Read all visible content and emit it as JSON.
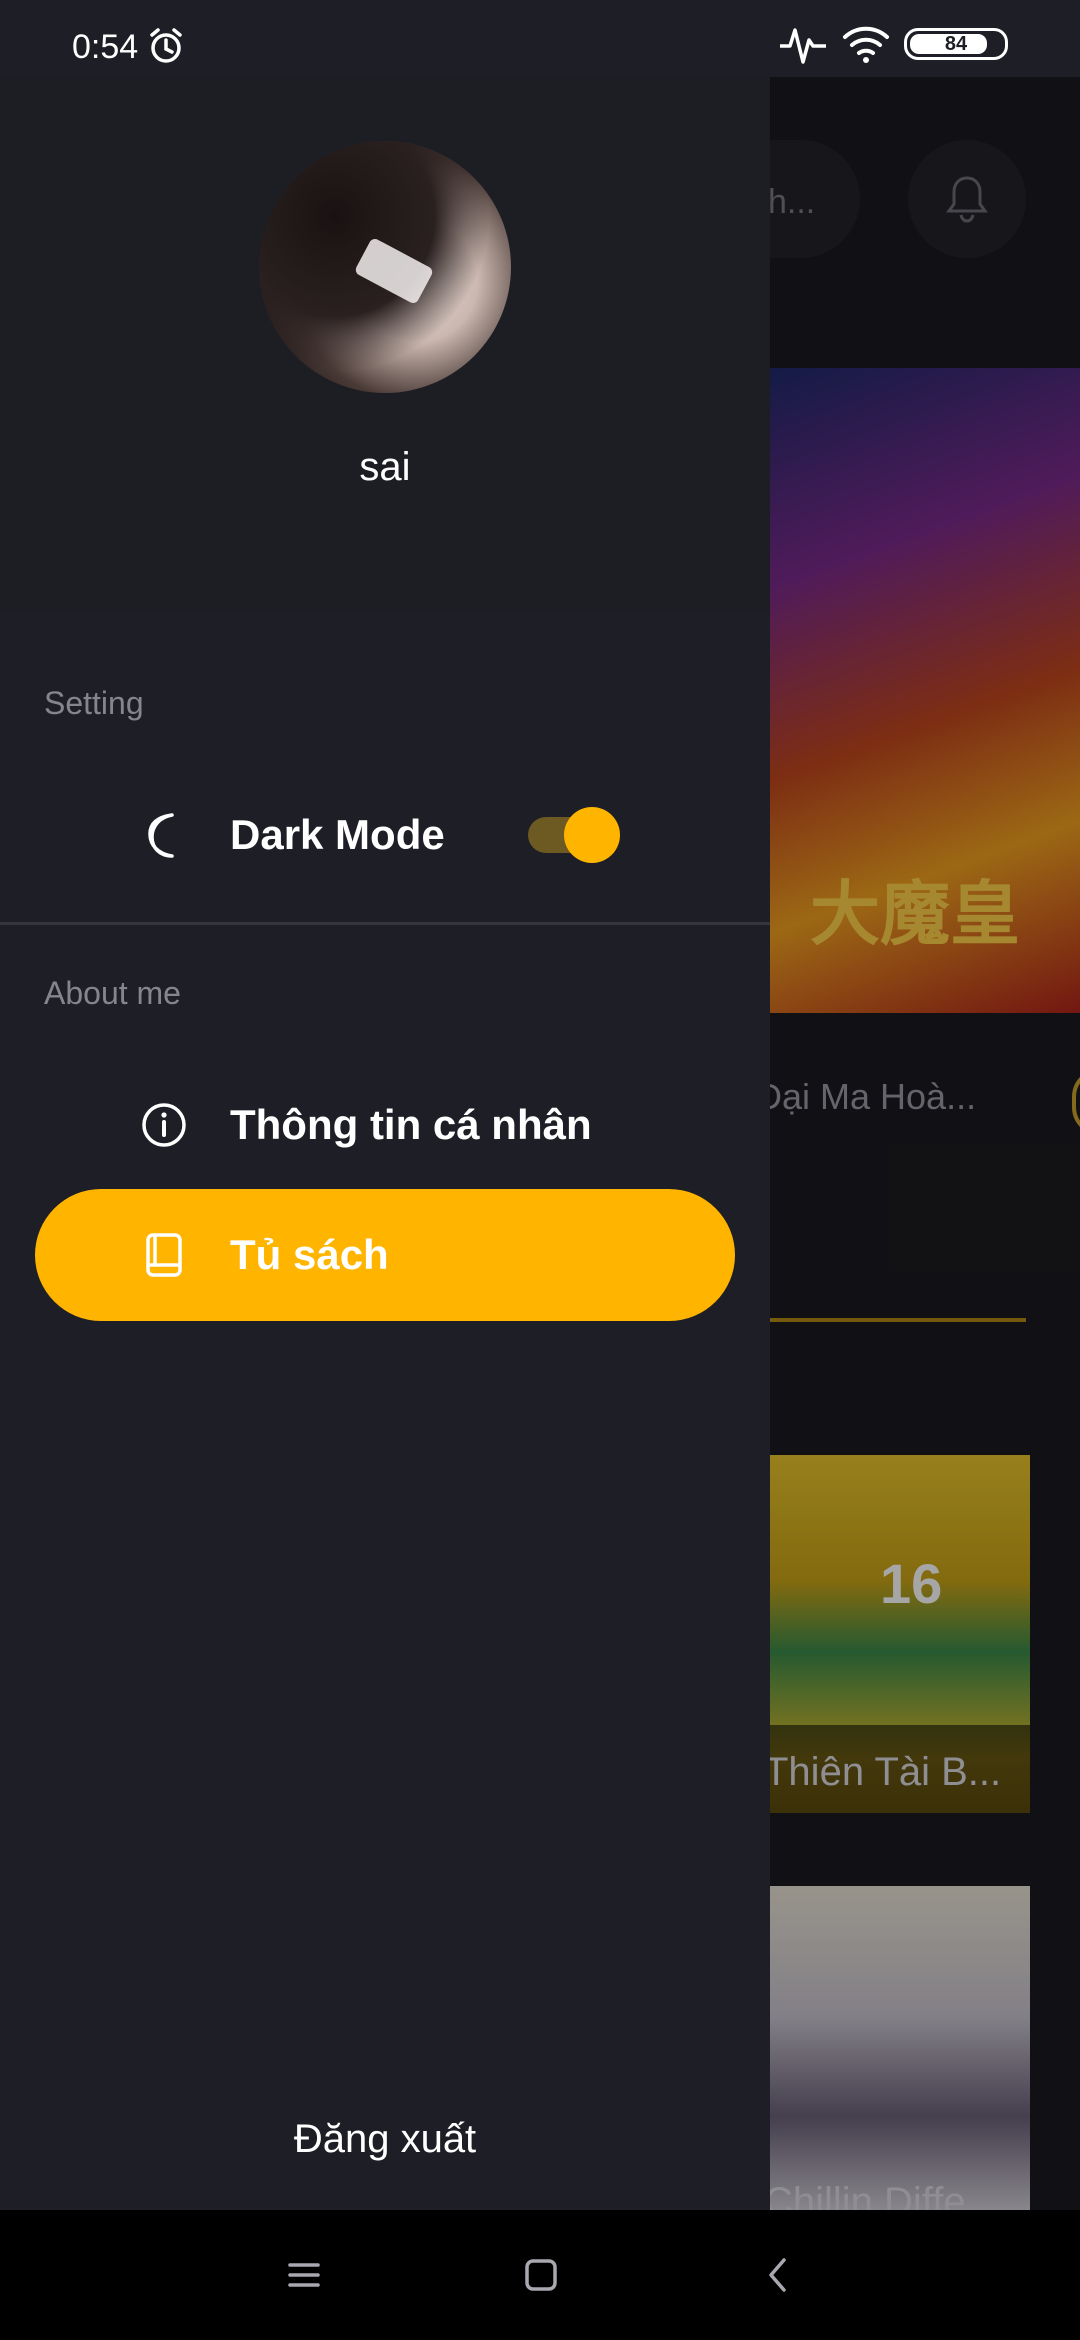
{
  "status_bar": {
    "time": "0:54",
    "battery": "84",
    "battery_level": 0.84,
    "icons": [
      "alarm-icon",
      "heartbeat-icon",
      "wifi-icon",
      "battery-icon"
    ]
  },
  "background": {
    "search_placeholder": "h...",
    "banner_text": "大魔皇",
    "title_1": "Đại Ma Hoà...",
    "cover_1_number": "16",
    "title_2": "Thiên Tài B...",
    "title_3": "Chillin Diffe"
  },
  "drawer": {
    "username": "sai",
    "setting_section": "Setting",
    "dark_mode_label": "Dark Mode",
    "dark_mode_on": true,
    "about_section": "About me",
    "personal_info_label": "Thông tin cá nhân",
    "bookshelf_label": "Tủ sách",
    "logout_label": "Đăng xuất"
  },
  "colors": {
    "accent": "#ffb400",
    "drawer_bg": "#1e1f26",
    "text_muted": "#85858d"
  }
}
